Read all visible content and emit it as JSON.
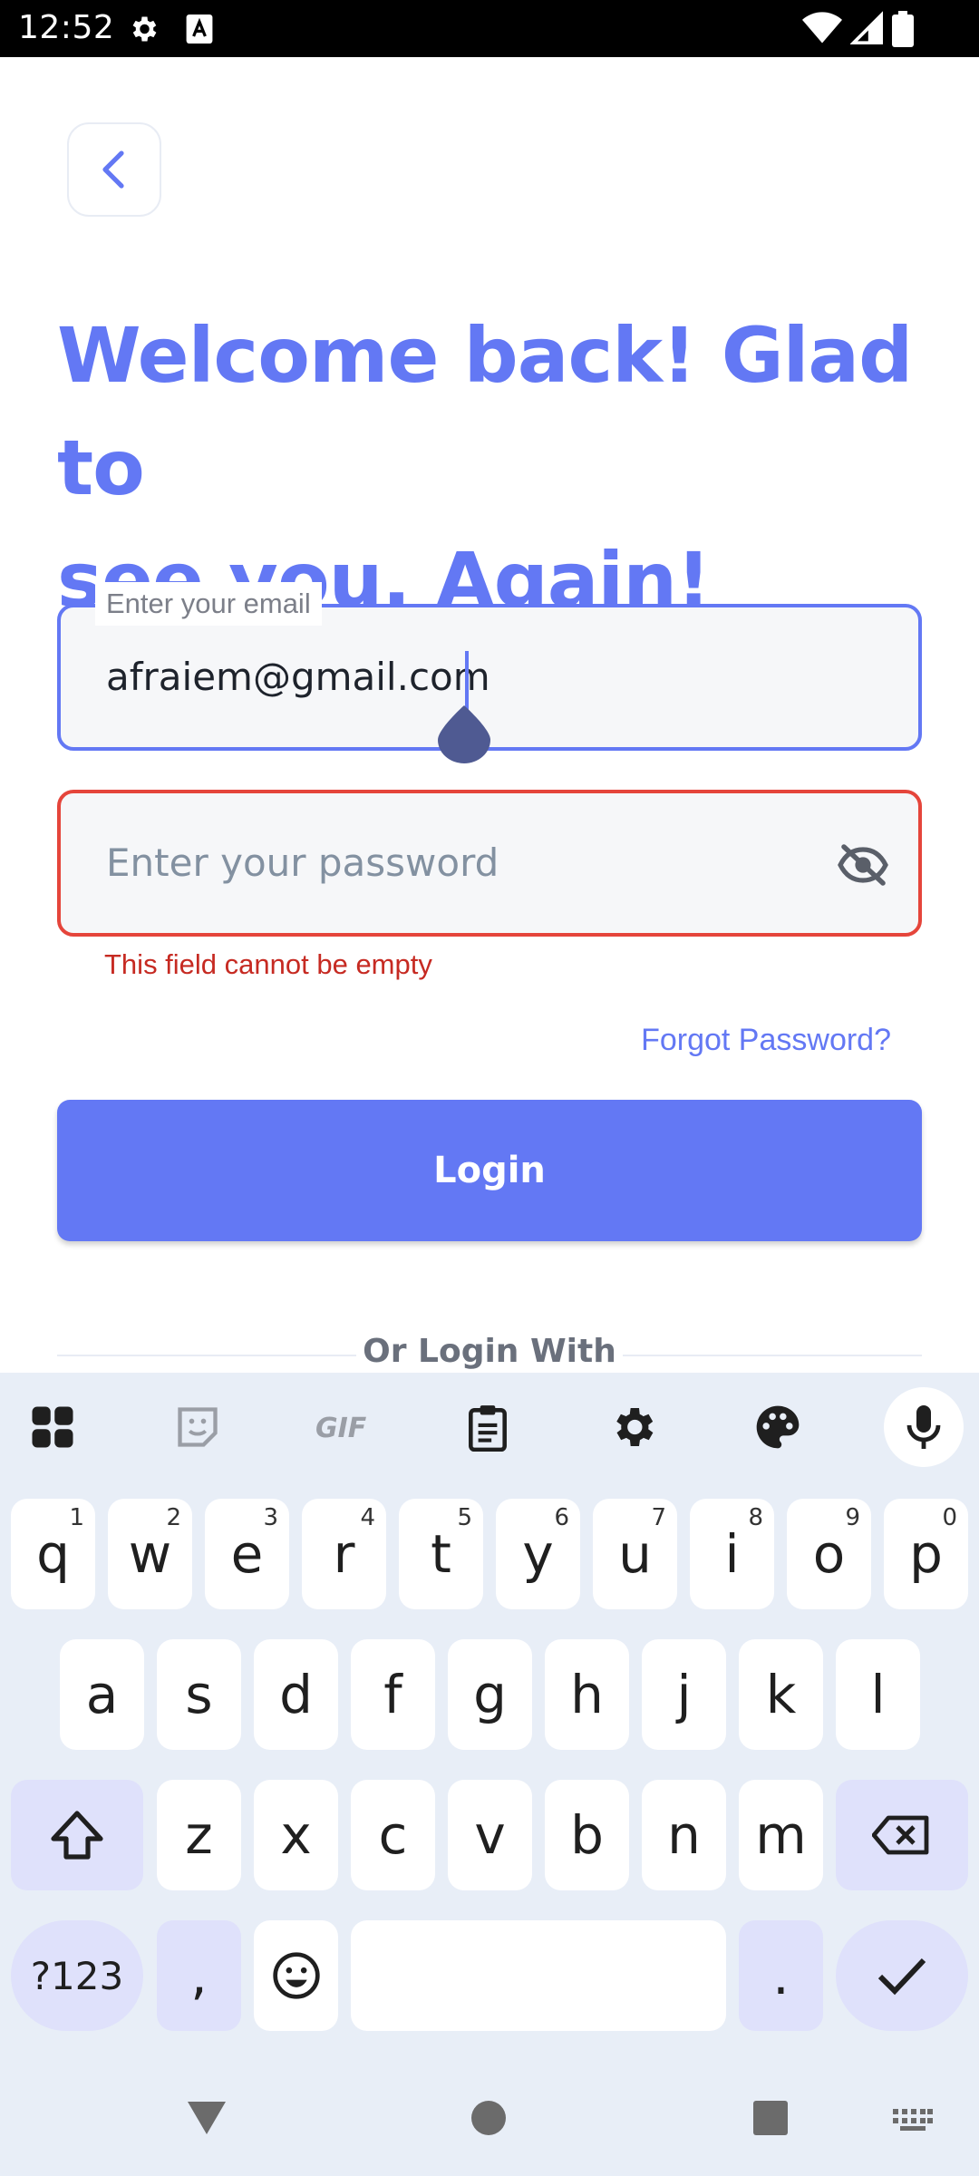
{
  "status_bar": {
    "time": "12:52"
  },
  "header": {
    "title_line1": "Welcome back! Glad to",
    "title_line2": "see you, Again!"
  },
  "form": {
    "email_label": "Enter your email",
    "email_value": "afraiem@gmail.com",
    "password_placeholder": "Enter your password",
    "password_error": "This field cannot be empty",
    "forgot_password": "Forgot Password?",
    "login_button": "Login",
    "or_login_with": "Or Login With"
  },
  "colors": {
    "accent": "#6378f4",
    "error": "#e5453b",
    "field_bg": "#f6f7f9"
  },
  "keyboard": {
    "row1": [
      {
        "k": "q",
        "h": "1"
      },
      {
        "k": "w",
        "h": "2"
      },
      {
        "k": "e",
        "h": "3"
      },
      {
        "k": "r",
        "h": "4"
      },
      {
        "k": "t",
        "h": "5"
      },
      {
        "k": "y",
        "h": "6"
      },
      {
        "k": "u",
        "h": "7"
      },
      {
        "k": "i",
        "h": "8"
      },
      {
        "k": "o",
        "h": "9"
      },
      {
        "k": "p",
        "h": "0"
      }
    ],
    "row2": [
      "a",
      "s",
      "d",
      "f",
      "g",
      "h",
      "j",
      "k",
      "l"
    ],
    "row3": [
      "z",
      "x",
      "c",
      "v",
      "b",
      "n",
      "m"
    ],
    "symbols_key": "?123",
    "comma_key": ",",
    "period_key": "."
  }
}
